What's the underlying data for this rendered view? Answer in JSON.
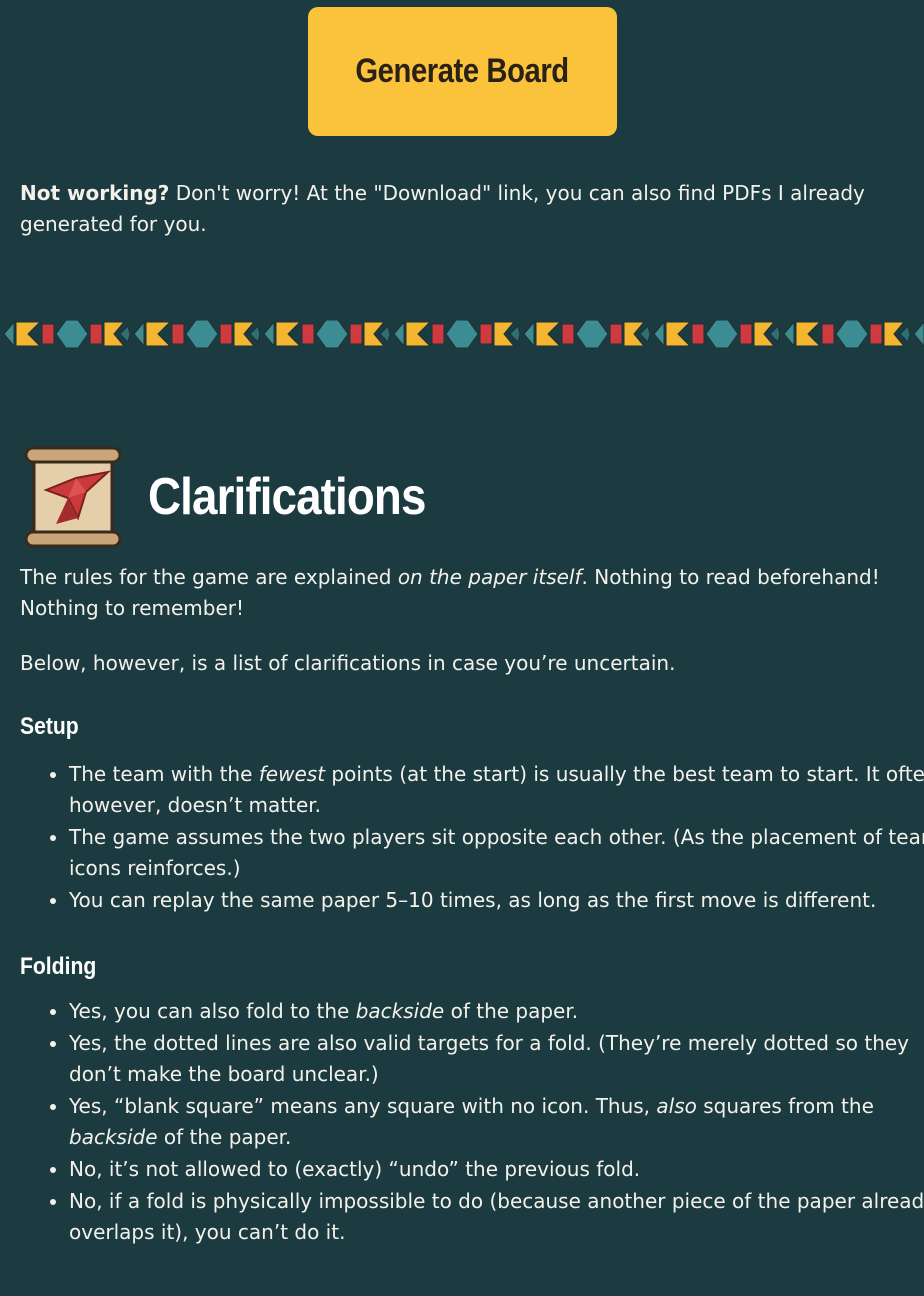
{
  "button": {
    "label": "Generate Board"
  },
  "notice": {
    "strong": "Not working?",
    "text": " Don't worry! At the \"Download\" link, you can also find PDFs I already generated for you."
  },
  "section": {
    "title": "Clarifications",
    "intro_a": "The rules for the game are explained ",
    "intro_em": "on the paper itself",
    "intro_b": ". Nothing to read beforehand! Nothing to remember!",
    "below": "Below, however, is a list of clarifications in case you’re uncertain."
  },
  "setup": {
    "heading": "Setup",
    "item1_a": "The team with the ",
    "item1_em": "fewest",
    "item1_b": " points (at the start) is usually the best team to start. It often, however, doesn’t matter.",
    "item2": "The game assumes the two players sit opposite each other. (As the placement of team icons reinforces.)",
    "item3": "You can replay the same paper 5–10 times, as long as the first move is different."
  },
  "folding": {
    "heading": "Folding",
    "item1_a": "Yes, you can also fold to the ",
    "item1_em": "backside",
    "item1_b": " of the paper.",
    "item2": "Yes, the dotted lines are also valid targets for a fold. (They’re merely dotted so they don’t make the board unclear.)",
    "item3_a": "Yes, “blank square” means any square with no icon. Thus, ",
    "item3_em": "also",
    "item3_b": " squares from the ",
    "item3_em2": "backside",
    "item3_c": " of the paper.",
    "item4": "No, it’s not allowed to (exactly) “undo” the previous fold.",
    "item5": "No, if a fold is physically impossible to do (because another piece of the paper already overlaps it), you can’t do it."
  },
  "colors": {
    "background": "#1b3b41",
    "button": "#fbc23b",
    "text": "#f3f1ea"
  },
  "icons": {
    "divider": "origami-pattern-divider",
    "scroll": "scroll-bird-icon"
  }
}
